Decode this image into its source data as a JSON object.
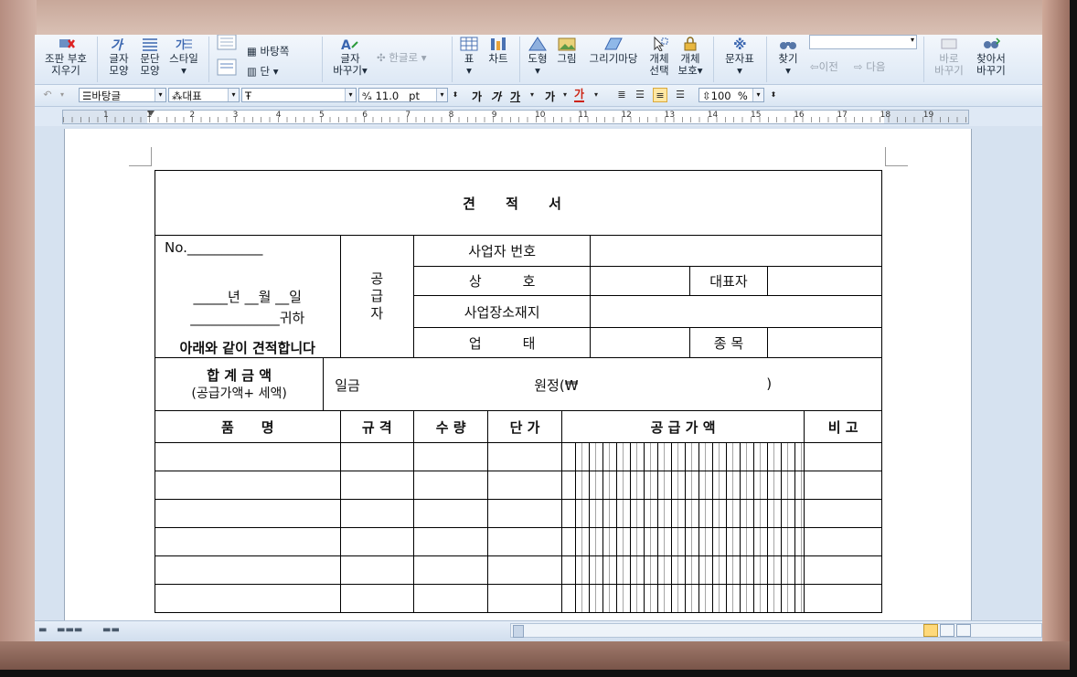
{
  "ribbon": {
    "groups": [
      {
        "id": "clear",
        "label": "조판 부호 지우기"
      },
      {
        "id": "charshape",
        "label": "글자 모양"
      },
      {
        "id": "parashape",
        "label": "문단 모양"
      },
      {
        "id": "style",
        "label": "스타일"
      },
      {
        "id": "background",
        "label": "바탕쪽"
      },
      {
        "id": "column",
        "label": "단"
      },
      {
        "id": "charchange",
        "label": "글자 바꾸기"
      },
      {
        "id": "hangul",
        "label": "한글로"
      },
      {
        "id": "table",
        "label": "표"
      },
      {
        "id": "chart",
        "label": "차트"
      },
      {
        "id": "shape",
        "label": "도형"
      },
      {
        "id": "picture",
        "label": "그림"
      },
      {
        "id": "drawmarket",
        "label": "그리기마당"
      },
      {
        "id": "objselect",
        "label": "개체 선택"
      },
      {
        "id": "objprotect",
        "label": "개체 보호"
      },
      {
        "id": "charmap",
        "label": "문자표"
      },
      {
        "id": "find",
        "label": "찾기"
      },
      {
        "id": "prev",
        "label": "이전"
      },
      {
        "id": "next",
        "label": "다음"
      },
      {
        "id": "replace_now",
        "label": "바로 바꾸기"
      },
      {
        "id": "find_replace",
        "label": "찾아서 바꾸기"
      }
    ]
  },
  "format": {
    "style": "바탕글",
    "lang": "대표",
    "font": "",
    "size": "11.0",
    "size_unit": "pt",
    "bold": "가",
    "italic": "가",
    "underline": "가",
    "strike": "가",
    "color": "가",
    "zoom": "100",
    "zoom_unit": "%"
  },
  "ruler": {
    "numbers": [
      "1",
      "1",
      "2",
      "3",
      "4",
      "5",
      "6",
      "7",
      "8",
      "9",
      "10",
      "11",
      "12",
      "13",
      "14",
      "15",
      "16",
      "17",
      "18",
      "19"
    ]
  },
  "form": {
    "title": "견 적 서",
    "no_label": "No.___________",
    "date_line": "_____년 __월 __일",
    "recipient_line": "_____________귀하",
    "statement": "아래와 같이 견적합니다",
    "supplier_vertical": [
      "공",
      "급",
      "자"
    ],
    "biz_number": "사업자 번호",
    "company": "상　　　호",
    "representative": "대표자",
    "address": "사업장소재지",
    "biz_type": "업　　　태",
    "biz_item": "종 목",
    "total_label": "합 계 금 액",
    "total_sub": "(공급가액+ 세액)",
    "amount_prefix": "일금",
    "amount_won": "원정(₩",
    "amount_close": ")",
    "columns": {
      "item": "품　　명",
      "spec": "규 격",
      "qty": "수 량",
      "unit_price": "단 가",
      "supply_amount": "공 급 가 액",
      "note": "비 고"
    }
  }
}
